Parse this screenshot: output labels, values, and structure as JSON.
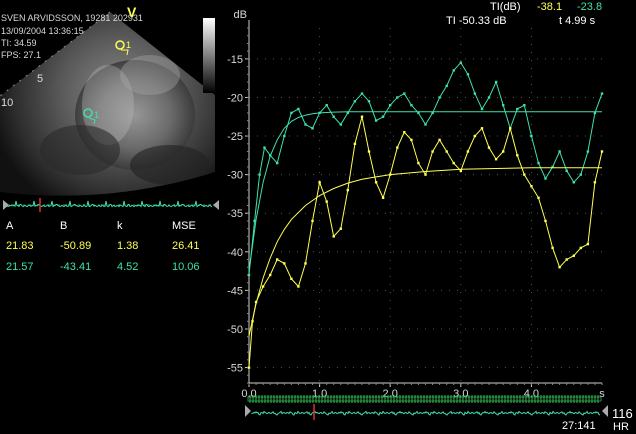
{
  "patient": {
    "name_line": "SVEN ARVIDSSON, 19281 202931",
    "date_line": "13/09/2004 13:36:15",
    "ti_line": "TI: 34.59",
    "fps_line": "FPS: 27.1"
  },
  "echo": {
    "depth_marks": [
      "5",
      "10"
    ],
    "apex_label": "V",
    "roi_labels": [
      "1",
      "1"
    ]
  },
  "readout": {
    "ti_db_label": "TI(dB)",
    "ti_db_yellow": "-38.1",
    "ti_db_green": "-23.8",
    "ti_value": "TI -50.33 dB",
    "time_value": "t 4.99 s"
  },
  "fit_table": {
    "headers": [
      "A",
      "B",
      "k",
      "MSE"
    ],
    "rows": [
      {
        "color": "#ffff55",
        "cells": [
          "21.83",
          "-50.89",
          "1.38",
          "26.41"
        ]
      },
      {
        "color": "#3fe0b0",
        "cells": [
          "21.57",
          "-43.41",
          "4.52",
          "10.06"
        ]
      }
    ]
  },
  "bottom": {
    "frame_counter": "27:141",
    "hr_value": "116",
    "hr_label": "HR"
  },
  "chart_data": {
    "type": "line",
    "ylabel": "dB",
    "xlabel": "s",
    "ylim": [
      -57,
      -11
    ],
    "xlim": [
      0,
      5
    ],
    "yticks": [
      "-15",
      "-20",
      "-25",
      "-30",
      "-35",
      "-40",
      "-45",
      "-50",
      "-55"
    ],
    "xticks": [
      "0.0",
      "1.0",
      "2.0",
      "3.0",
      "4.0"
    ],
    "grid": true,
    "series": [
      {
        "color": "#3fe0b0",
        "x": [
          0.0,
          0.08,
          0.15,
          0.22,
          0.3,
          0.4,
          0.5,
          0.6,
          0.7,
          0.8,
          0.9,
          1.0,
          1.1,
          1.2,
          1.3,
          1.4,
          1.5,
          1.6,
          1.7,
          1.8,
          1.9,
          2.0,
          2.1,
          2.2,
          2.3,
          2.4,
          2.5,
          2.6,
          2.7,
          2.8,
          2.9,
          3.0,
          3.1,
          3.2,
          3.3,
          3.4,
          3.5,
          3.6,
          3.7,
          3.8,
          3.9,
          4.0,
          4.1,
          4.2,
          4.3,
          4.4,
          4.5,
          4.6,
          4.7,
          4.8,
          4.9,
          5.0
        ],
        "y": [
          -43.0,
          -36.0,
          -30.0,
          -26.5,
          -27.5,
          -28.5,
          -25.0,
          -22.0,
          -21.5,
          -23.5,
          -24.0,
          -22.0,
          -21.0,
          -22.5,
          -23.5,
          -22.0,
          -20.5,
          -19.5,
          -20.5,
          -23.0,
          -22.5,
          -21.0,
          -20.0,
          -19.5,
          -21.0,
          -22.0,
          -23.5,
          -22.0,
          -20.0,
          -18.5,
          -16.5,
          -15.5,
          -17.0,
          -19.5,
          -21.5,
          -20.0,
          -18.0,
          -21.0,
          -24.0,
          -21.5,
          -21.0,
          -25.0,
          -28.5,
          -30.5,
          -29.0,
          -27.0,
          -29.5,
          -31.0,
          -30.0,
          -27.0,
          -22.0,
          -19.5
        ]
      },
      {
        "color": "#3fe0b0",
        "x": [
          0.0,
          0.1,
          0.2,
          0.3,
          0.4,
          0.5,
          0.6,
          0.7,
          0.8,
          0.9,
          1.0,
          1.2,
          1.4,
          1.6,
          1.8,
          2.0,
          2.5,
          3.0,
          3.5,
          4.0,
          4.5,
          5.0
        ],
        "y": [
          -42.5,
          -35.8,
          -31.0,
          -27.6,
          -25.5,
          -24.0,
          -23.1,
          -22.6,
          -22.3,
          -22.1,
          -22.0,
          -21.9,
          -21.85,
          -21.84,
          -21.84,
          -21.84,
          -21.84,
          -21.84,
          -21.84,
          -21.84,
          -21.84,
          -21.84
        ]
      },
      {
        "color": "#ffff55",
        "x": [
          0.0,
          0.05,
          0.1,
          0.2,
          0.3,
          0.4,
          0.5,
          0.6,
          0.7,
          0.8,
          0.9,
          1.0,
          1.1,
          1.2,
          1.3,
          1.4,
          1.5,
          1.6,
          1.7,
          1.8,
          1.9,
          2.0,
          2.1,
          2.2,
          2.3,
          2.4,
          2.5,
          2.6,
          2.7,
          2.8,
          2.9,
          3.0,
          3.1,
          3.2,
          3.3,
          3.4,
          3.5,
          3.6,
          3.7,
          3.8,
          3.9,
          4.0,
          4.1,
          4.2,
          4.3,
          4.4,
          4.5,
          4.6,
          4.7,
          4.8,
          4.9,
          5.0
        ],
        "y": [
          -55.0,
          -49.0,
          -46.5,
          -44.5,
          -43.0,
          -41.0,
          -41.5,
          -43.5,
          -44.5,
          -41.5,
          -36.0,
          -31.0,
          -33.5,
          -38.0,
          -37.0,
          -32.0,
          -26.0,
          -22.5,
          -27.0,
          -31.0,
          -33.0,
          -30.0,
          -26.5,
          -24.5,
          -25.5,
          -28.5,
          -30.0,
          -27.0,
          -25.5,
          -27.0,
          -28.5,
          -29.5,
          -27.0,
          -25.0,
          -24.0,
          -26.5,
          -28.0,
          -27.0,
          -24.0,
          -27.5,
          -30.0,
          -31.5,
          -33.0,
          -36.0,
          -39.5,
          -42.0,
          -41.0,
          -40.5,
          -39.5,
          -39.0,
          -31.0,
          -27.0
        ]
      },
      {
        "color": "#ffff55",
        "x": [
          0.0,
          0.1,
          0.2,
          0.3,
          0.4,
          0.5,
          0.6,
          0.8,
          1.0,
          1.2,
          1.4,
          1.6,
          1.8,
          2.0,
          2.5,
          3.0,
          3.5,
          4.0,
          4.5,
          5.0
        ],
        "y": [
          -50.9,
          -46.7,
          -43.4,
          -40.8,
          -38.7,
          -37.1,
          -35.8,
          -34.0,
          -32.7,
          -31.8,
          -31.1,
          -30.6,
          -30.3,
          -30.0,
          -29.6,
          -29.3,
          -29.2,
          -29.1,
          -29.1,
          -29.1
        ]
      }
    ]
  }
}
